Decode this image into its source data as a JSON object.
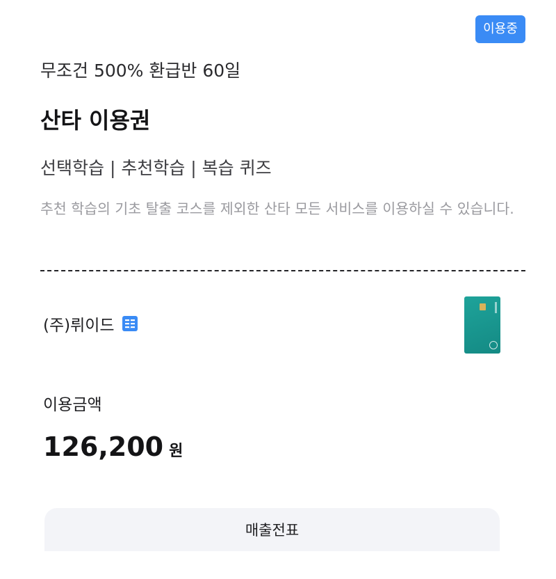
{
  "status_badge": "이용중",
  "plan": {
    "subtitle": "무조건 500% 환급반 60일",
    "title": "산타 이용권",
    "features": "선택학습 | 추천학습 | 복습 퀴즈",
    "description": "추천 학습의 기초 탈출 코스를 제외한 산타 모든 서비스를 이용하실 수 있습니다."
  },
  "merchant": {
    "name": "(주)뤼이드",
    "icon": "company-document-icon"
  },
  "card": {
    "icon": "credit-card-icon",
    "color": "#1a9b93"
  },
  "payment": {
    "label": "이용금액",
    "amount": "126,200",
    "unit": "원"
  },
  "receipt_button": "매출전표",
  "colors": {
    "accent": "#3a8bf5",
    "description": "#9a9a9f",
    "button_bg": "#f3f4f8"
  }
}
